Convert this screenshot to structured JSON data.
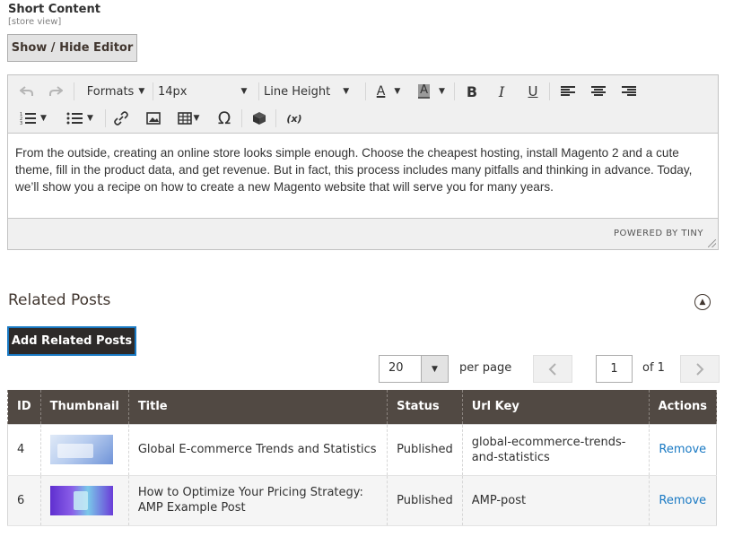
{
  "short_content": {
    "label": "Short Content",
    "scope": "[store view]",
    "toggle_button": "Show / Hide Editor"
  },
  "editor": {
    "toolbar": {
      "formats": "Formats",
      "font_size": "14px",
      "line_height": "Line Height",
      "font_color_glyph": "A",
      "bg_color_glyph": "A",
      "bold": "B",
      "italic": "I",
      "underline": "U",
      "special_char": "Ω",
      "variable": "(x)"
    },
    "content": "From the outside, creating an online store looks simple enough. Choose the cheapest hosting, install Magento 2 and a cute theme, fill in the product data, and get revenue. But in fact, this process includes many pitfalls and thinking in advance. Today, we’ll show you a recipe on how to create a new Magento website that will serve you for many years.",
    "powered_by": "POWERED BY TINY",
    "icons": [
      "undo-icon",
      "redo-icon",
      "align-left-icon",
      "align-center-icon",
      "align-right-icon",
      "numbered-list-icon",
      "bullet-list-icon",
      "link-icon",
      "image-icon",
      "table-icon",
      "widget-icon"
    ]
  },
  "related_posts": {
    "title": "Related Posts",
    "add_button": "Add Related Posts",
    "pager": {
      "per_page_value": "20",
      "per_page_label": "per page",
      "current_page": "1",
      "total_label": "of 1"
    },
    "columns": [
      "ID",
      "Thumbnail",
      "Title",
      "Status",
      "Url Key",
      "Actions"
    ],
    "rows": [
      {
        "id": "4",
        "title": "Global E-commerce Trends and Statistics",
        "status": "Published",
        "url_key": "global-ecommerce-trends-and-statistics",
        "action": "Remove"
      },
      {
        "id": "6",
        "title": "How to Optimize Your Pricing Strategy: AMP Example Post",
        "status": "Published",
        "url_key": "AMP-post",
        "action": "Remove"
      }
    ]
  },
  "colors": {
    "header_bg": "#514943",
    "add_button_bg": "#2d2a29",
    "link": "#1979c3"
  }
}
